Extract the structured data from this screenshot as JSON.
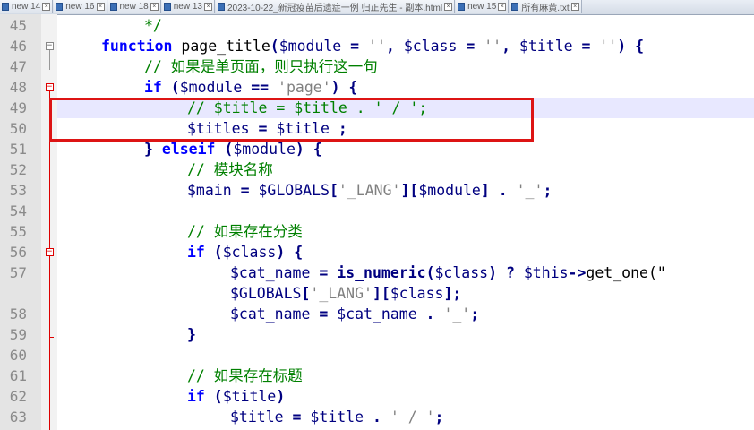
{
  "tabs": [
    {
      "label": "new 14"
    },
    {
      "label": "new 16"
    },
    {
      "label": "new 18"
    },
    {
      "label": "new 13"
    },
    {
      "label": "2023-10-22_新冠疫苗后遗症一例  归正先生 - 副本.html"
    },
    {
      "label": "new 15"
    },
    {
      "label": "所有麻黄.txt"
    }
  ],
  "lines": [
    {
      "num": "45",
      "indent": 2,
      "tokens": [
        {
          "t": "*/",
          "c": "cm"
        }
      ]
    },
    {
      "num": "46",
      "indent": 1,
      "tokens": [
        {
          "t": "function",
          "c": "kw"
        },
        {
          "t": " page_title",
          "c": "pl"
        },
        {
          "t": "(",
          "c": "op"
        },
        {
          "t": "$module",
          "c": "vr"
        },
        {
          "t": " = ",
          "c": "op"
        },
        {
          "t": "''",
          "c": "st"
        },
        {
          "t": ", ",
          "c": "op"
        },
        {
          "t": "$class",
          "c": "vr"
        },
        {
          "t": " = ",
          "c": "op"
        },
        {
          "t": "''",
          "c": "st"
        },
        {
          "t": ", ",
          "c": "op"
        },
        {
          "t": "$title",
          "c": "vr"
        },
        {
          "t": " = ",
          "c": "op"
        },
        {
          "t": "''",
          "c": "st"
        },
        {
          "t": ") {",
          "c": "op"
        }
      ]
    },
    {
      "num": "47",
      "indent": 2,
      "tokens": [
        {
          "t": "// 如果是单页面，则只执行这一句",
          "c": "cm"
        }
      ]
    },
    {
      "num": "48",
      "indent": 2,
      "tokens": [
        {
          "t": "if",
          "c": "kw"
        },
        {
          "t": " (",
          "c": "op"
        },
        {
          "t": "$module",
          "c": "vr"
        },
        {
          "t": " == ",
          "c": "op"
        },
        {
          "t": "'page'",
          "c": "st"
        },
        {
          "t": ") {",
          "c": "op"
        }
      ]
    },
    {
      "num": "49",
      "indent": 3,
      "highlight": true,
      "tokens": [
        {
          "t": "// $title = $title . ' / ';",
          "c": "cm"
        }
      ]
    },
    {
      "num": "50",
      "indent": 3,
      "tokens": [
        {
          "t": "$titles",
          "c": "vr"
        },
        {
          "t": " = ",
          "c": "op"
        },
        {
          "t": "$title",
          "c": "vr"
        },
        {
          "t": " ;",
          "c": "op"
        }
      ]
    },
    {
      "num": "51",
      "indent": 2,
      "tokens": [
        {
          "t": "} ",
          "c": "op"
        },
        {
          "t": "elseif",
          "c": "kw"
        },
        {
          "t": " (",
          "c": "op"
        },
        {
          "t": "$module",
          "c": "vr"
        },
        {
          "t": ") {",
          "c": "op"
        }
      ]
    },
    {
      "num": "52",
      "indent": 3,
      "tokens": [
        {
          "t": "// 模块名称",
          "c": "cm"
        }
      ]
    },
    {
      "num": "53",
      "indent": 3,
      "tokens": [
        {
          "t": "$main",
          "c": "vr"
        },
        {
          "t": " = ",
          "c": "op"
        },
        {
          "t": "$GLOBALS",
          "c": "vr"
        },
        {
          "t": "[",
          "c": "op"
        },
        {
          "t": "'_LANG'",
          "c": "st"
        },
        {
          "t": "][",
          "c": "op"
        },
        {
          "t": "$module",
          "c": "vr"
        },
        {
          "t": "] . ",
          "c": "op"
        },
        {
          "t": "'_'",
          "c": "st"
        },
        {
          "t": ";",
          "c": "op"
        }
      ]
    },
    {
      "num": "54",
      "indent": 0,
      "tokens": []
    },
    {
      "num": "55",
      "indent": 3,
      "tokens": [
        {
          "t": "// 如果存在分类",
          "c": "cm"
        }
      ]
    },
    {
      "num": "56",
      "indent": 3,
      "tokens": [
        {
          "t": "if",
          "c": "kw"
        },
        {
          "t": " (",
          "c": "op"
        },
        {
          "t": "$class",
          "c": "vr"
        },
        {
          "t": ") {",
          "c": "op"
        }
      ]
    },
    {
      "num": "57",
      "indent": 4,
      "tokens": [
        {
          "t": "$cat_name",
          "c": "vr"
        },
        {
          "t": " = ",
          "c": "op"
        },
        {
          "t": "is_numeric",
          "c": "fn"
        },
        {
          "t": "(",
          "c": "op"
        },
        {
          "t": "$class",
          "c": "vr"
        },
        {
          "t": ") ? ",
          "c": "op"
        },
        {
          "t": "$this",
          "c": "vr"
        },
        {
          "t": "->",
          "c": "op"
        },
        {
          "t": "get_one(\"",
          "c": "pl"
        }
      ]
    },
    {
      "num": "",
      "indent": 4,
      "tokens": [
        {
          "t": "$GLOBALS",
          "c": "vr"
        },
        {
          "t": "[",
          "c": "op"
        },
        {
          "t": "'_LANG'",
          "c": "st"
        },
        {
          "t": "][",
          "c": "op"
        },
        {
          "t": "$class",
          "c": "vr"
        },
        {
          "t": "];",
          "c": "op"
        }
      ]
    },
    {
      "num": "58",
      "indent": 4,
      "tokens": [
        {
          "t": "$cat_name",
          "c": "vr"
        },
        {
          "t": " = ",
          "c": "op"
        },
        {
          "t": "$cat_name",
          "c": "vr"
        },
        {
          "t": " . ",
          "c": "op"
        },
        {
          "t": "'_'",
          "c": "st"
        },
        {
          "t": ";",
          "c": "op"
        }
      ]
    },
    {
      "num": "59",
      "indent": 3,
      "tokens": [
        {
          "t": "}",
          "c": "op"
        }
      ]
    },
    {
      "num": "60",
      "indent": 0,
      "tokens": []
    },
    {
      "num": "61",
      "indent": 3,
      "tokens": [
        {
          "t": "// 如果存在标题",
          "c": "cm"
        }
      ]
    },
    {
      "num": "62",
      "indent": 3,
      "tokens": [
        {
          "t": "if",
          "c": "kw"
        },
        {
          "t": " (",
          "c": "op"
        },
        {
          "t": "$title",
          "c": "vr"
        },
        {
          "t": ")",
          "c": "op"
        }
      ]
    },
    {
      "num": "63",
      "indent": 4,
      "tokens": [
        {
          "t": "$title",
          "c": "vr"
        },
        {
          "t": " = ",
          "c": "op"
        },
        {
          "t": "$title",
          "c": "vr"
        },
        {
          "t": " . ",
          "c": "op"
        },
        {
          "t": "' / '",
          "c": "st"
        },
        {
          "t": ";",
          "c": "op"
        }
      ]
    }
  ],
  "colors": {
    "annotation_box": "#dd1414",
    "current_line": "#e8e8ff",
    "keyword": "#0000ff",
    "comment": "#008000"
  }
}
